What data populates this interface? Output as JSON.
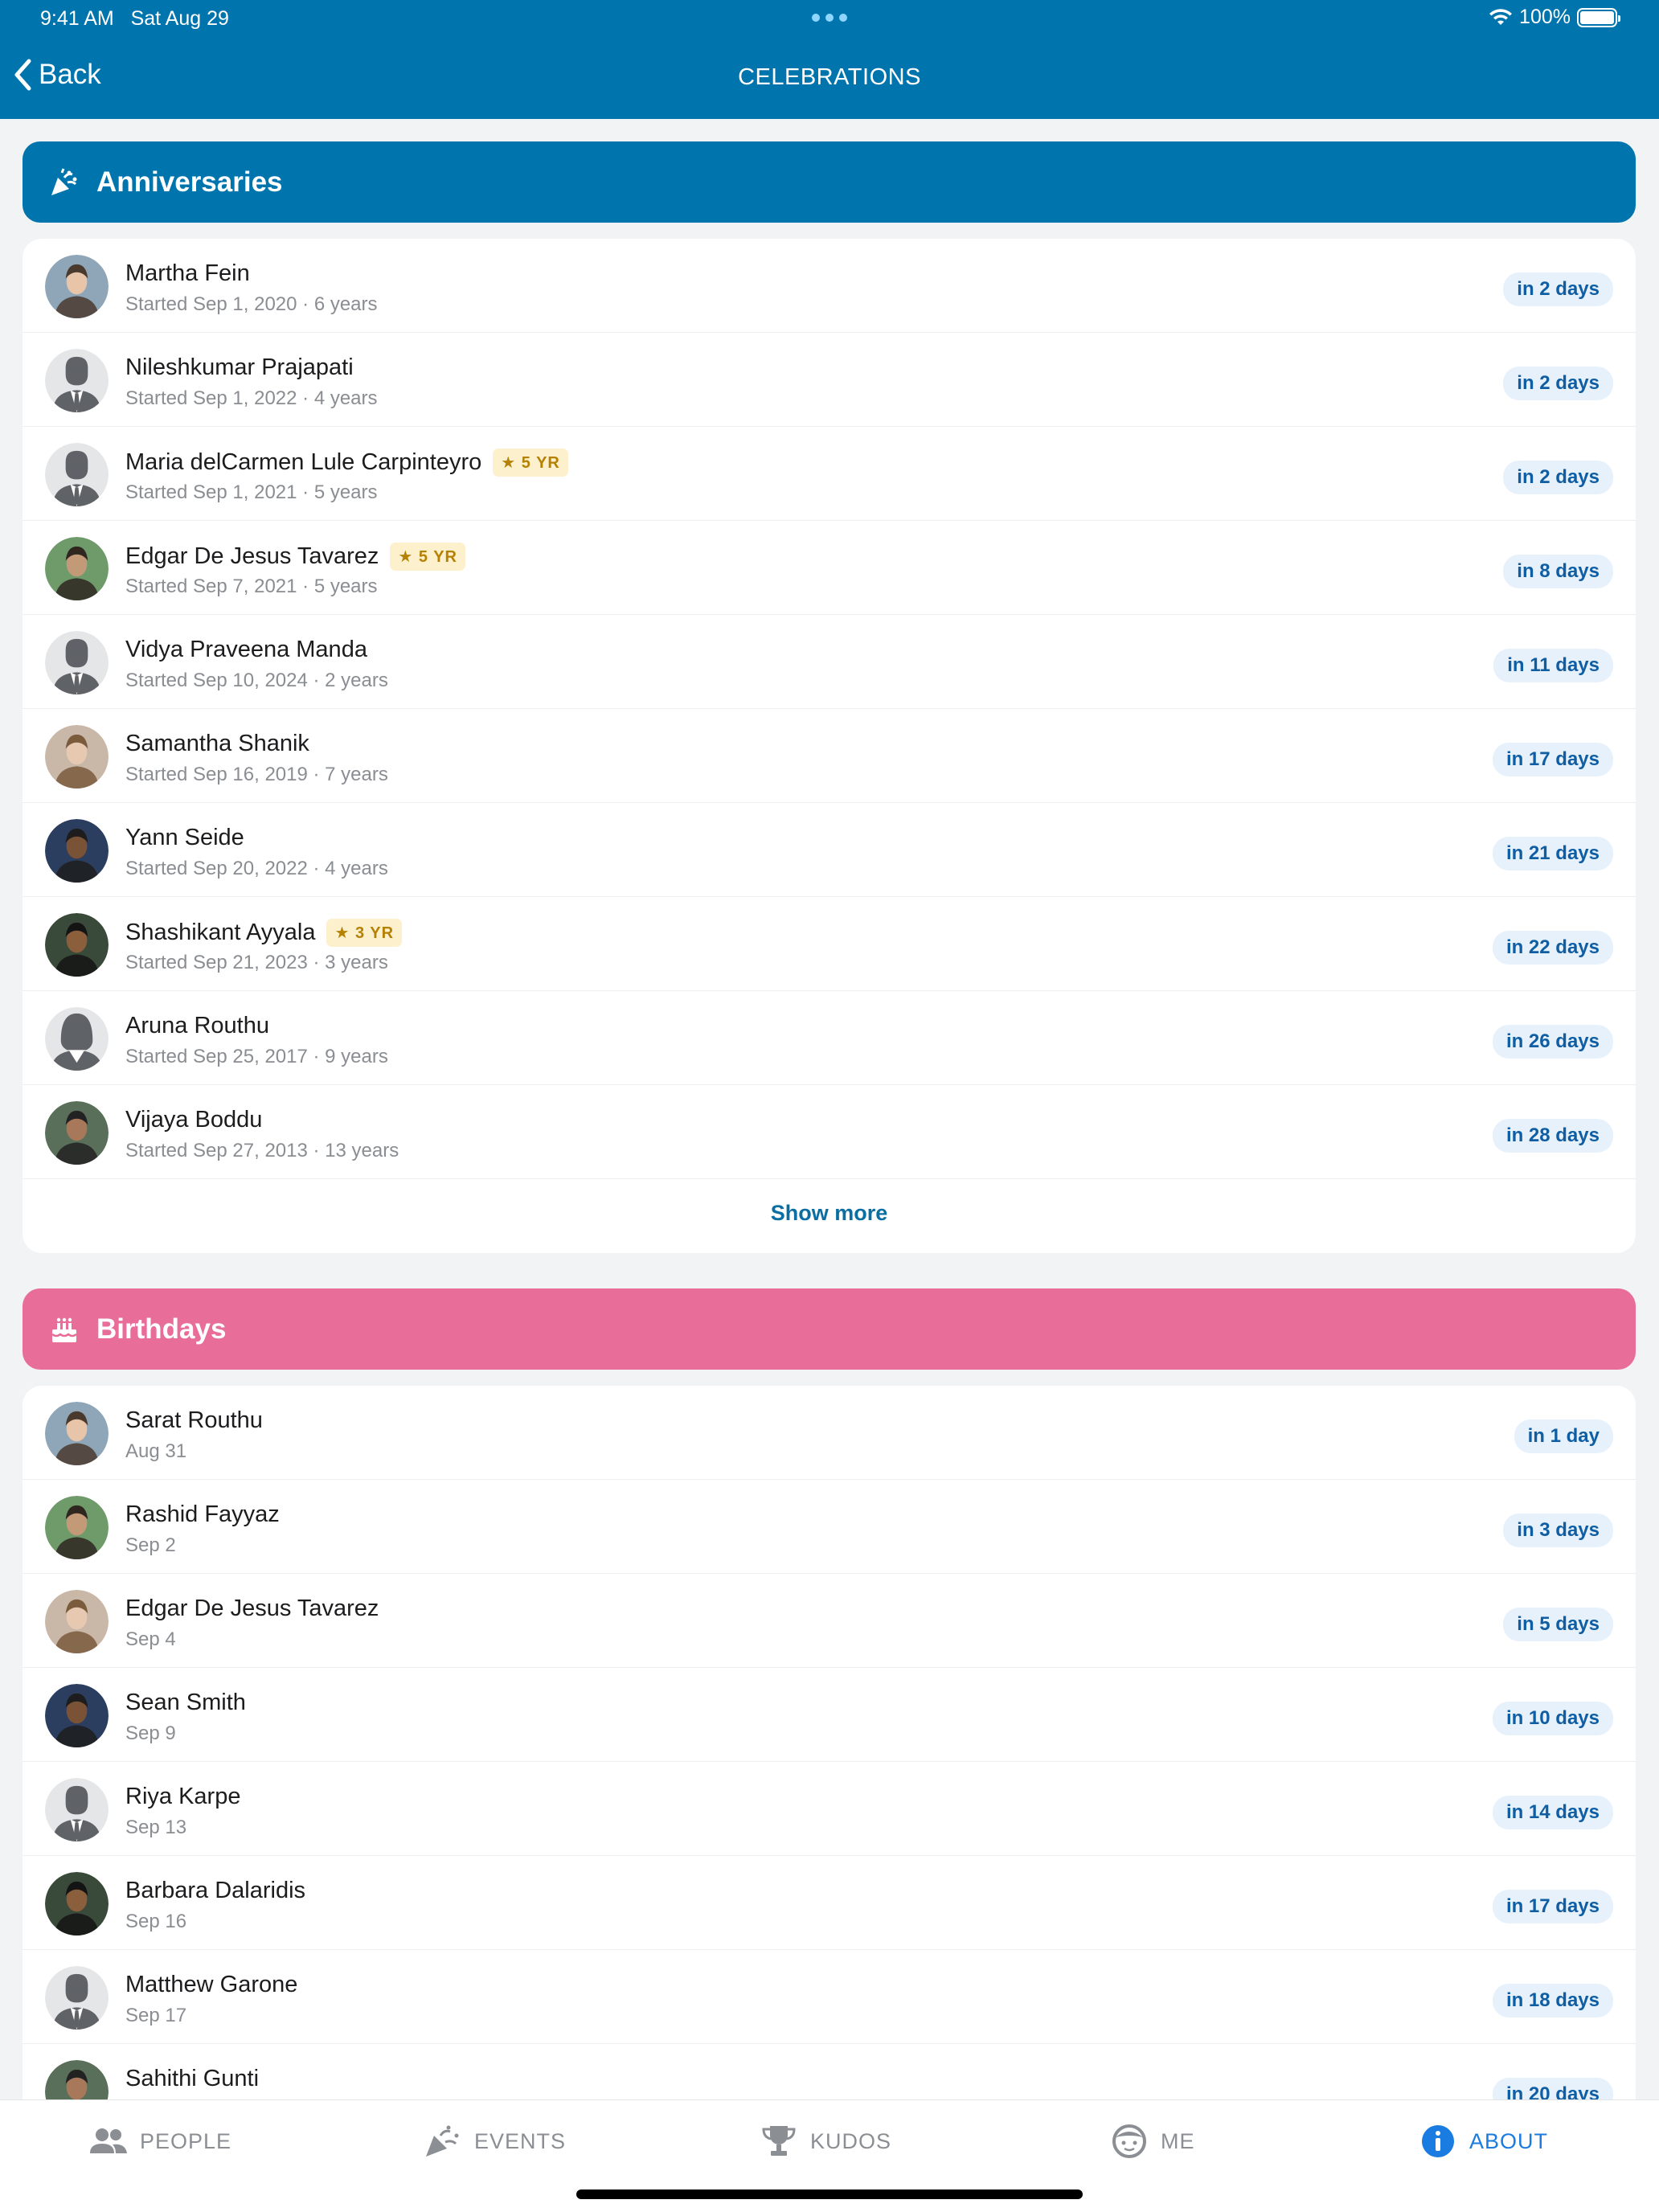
{
  "status_bar": {
    "time": "9:41 AM",
    "date": "Sat Aug 29",
    "battery": "100%"
  },
  "nav": {
    "back_label": "Back",
    "title": "CELEBRATIONS"
  },
  "anniversaries": {
    "title": "Anniversaries",
    "items": [
      {
        "name": "Martha Fein",
        "sub": "Started Sep 1, 2020 · 6 years",
        "badge": "",
        "when": "in 2 days",
        "avatar": "photo"
      },
      {
        "name": "Nileshkumar Prajapati",
        "sub": "Started Sep 1, 2022 · 4 years",
        "badge": "",
        "when": "in 2 days",
        "avatar": "placeholder-male"
      },
      {
        "name": "Maria delCarmen Lule Carpinteyro",
        "sub": "Started Sep 1, 2021 · 5 years",
        "badge": "★ 5 YR",
        "when": "in 2 days",
        "avatar": "placeholder-male"
      },
      {
        "name": "Edgar De Jesus Tavarez",
        "sub": "Started Sep 7, 2021 · 5 years",
        "badge": "★ 5 YR",
        "when": "in 8 days",
        "avatar": "photo"
      },
      {
        "name": "Vidya Praveena Manda",
        "sub": "Started Sep 10, 2024 · 2 years",
        "badge": "",
        "when": "in 11 days",
        "avatar": "placeholder-male"
      },
      {
        "name": "Samantha Shanik",
        "sub": "Started Sep 16, 2019 · 7 years",
        "badge": "",
        "when": "in 17 days",
        "avatar": "photo"
      },
      {
        "name": "Yann Seide",
        "sub": "Started Sep 20, 2022 · 4 years",
        "badge": "",
        "when": "in 21 days",
        "avatar": "photo"
      },
      {
        "name": "Shashikant Ayyala",
        "sub": "Started Sep 21, 2023 · 3 years",
        "badge": "★ 3 YR",
        "when": "in 22 days",
        "avatar": "photo"
      },
      {
        "name": "Aruna Routhu",
        "sub": "Started Sep 25, 2017 · 9 years",
        "badge": "",
        "when": "in 26 days",
        "avatar": "placeholder-female"
      },
      {
        "name": "Vijaya Boddu",
        "sub": "Started Sep 27, 2013 · 13 years",
        "badge": "",
        "when": "in 28 days",
        "avatar": "photo"
      }
    ],
    "show_more": "Show more"
  },
  "birthdays": {
    "title": "Birthdays",
    "items": [
      {
        "name": "Sarat Routhu",
        "sub": "Aug 31",
        "when": "in 1 day",
        "avatar": "photo"
      },
      {
        "name": "Rashid Fayyaz",
        "sub": "Sep 2",
        "when": "in 3 days",
        "avatar": "photo"
      },
      {
        "name": "Edgar De Jesus Tavarez",
        "sub": "Sep 4",
        "when": "in 5 days",
        "avatar": "photo"
      },
      {
        "name": "Sean Smith",
        "sub": "Sep 9",
        "when": "in 10 days",
        "avatar": "photo"
      },
      {
        "name": "Riya Karpe",
        "sub": "Sep 13",
        "when": "in 14 days",
        "avatar": "placeholder-male"
      },
      {
        "name": "Barbara Dalaridis",
        "sub": "Sep 16",
        "when": "in 17 days",
        "avatar": "photo"
      },
      {
        "name": "Matthew Garone",
        "sub": "Sep 17",
        "when": "in 18 days",
        "avatar": "placeholder-male"
      },
      {
        "name": "Sahithi Gunti",
        "sub": "",
        "when": "in 20 days",
        "avatar": "photo"
      }
    ]
  },
  "tabs": [
    {
      "label": "PEOPLE",
      "icon": "people-icon",
      "active": false
    },
    {
      "label": "EVENTS",
      "icon": "party-popper-icon",
      "active": false
    },
    {
      "label": "KUDOS",
      "icon": "trophy-icon",
      "active": false
    },
    {
      "label": "ME",
      "icon": "face-icon",
      "active": false
    },
    {
      "label": "ABOUT",
      "icon": "info-icon",
      "active": true
    }
  ],
  "colors": {
    "brand_blue": "#0074ad",
    "birthday_pink": "#e86d98",
    "pill_bg": "#e7f1fb",
    "pill_text": "#0f5ea3",
    "active_tab": "#1a7be0"
  }
}
